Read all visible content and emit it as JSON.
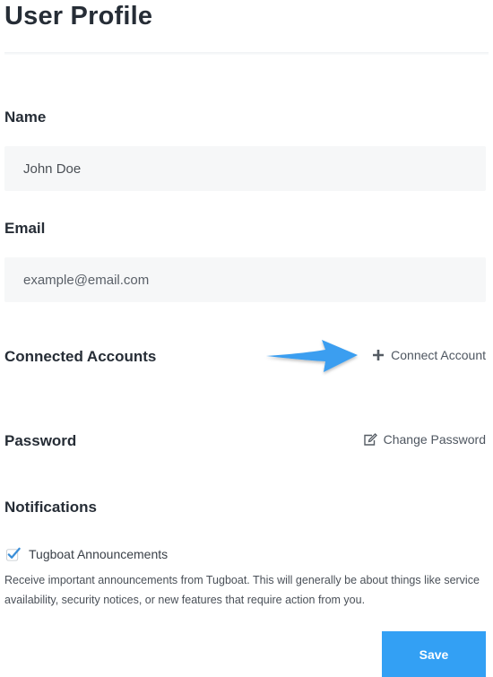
{
  "page": {
    "title": "User Profile"
  },
  "name": {
    "label": "Name",
    "value": "John Doe"
  },
  "email": {
    "label": "Email",
    "placeholder": "example@email.com"
  },
  "connected_accounts": {
    "label": "Connected Accounts",
    "action_label": "Connect Account",
    "action_icon": "plus-icon"
  },
  "annotation": {
    "icon": "arrow-right-icon",
    "color": "#3a9ef0"
  },
  "password": {
    "label": "Password",
    "action_label": "Change Password",
    "action_icon": "edit-icon"
  },
  "notifications": {
    "label": "Notifications",
    "options": [
      {
        "label": "Tugboat Announcements",
        "checked": true,
        "description": "Receive important announcements from Tugboat. This will generally be about things like service availability, security notices, or new features that require action from you."
      }
    ]
  },
  "actions": {
    "save_label": "Save",
    "accent": "#33a0f4"
  }
}
